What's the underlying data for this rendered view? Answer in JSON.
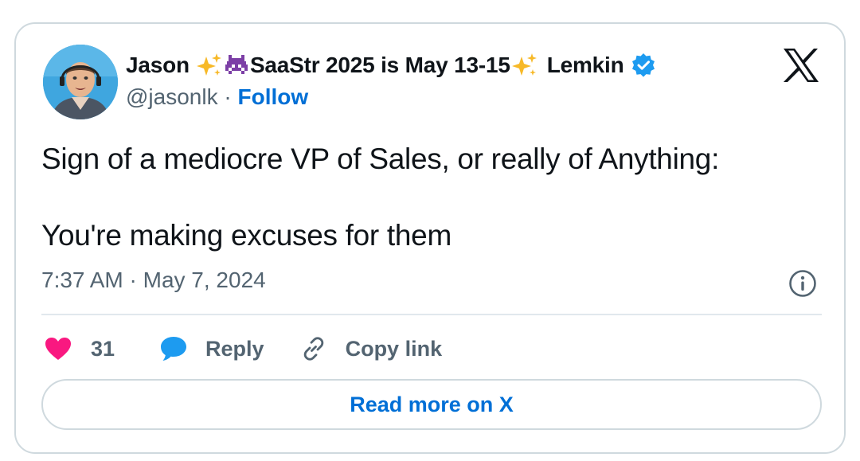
{
  "author": {
    "name_first": "Jason",
    "name_middle": "SaaStr 2025 is May 13-15",
    "name_last": "Lemkin",
    "handle": "@jasonlk",
    "separator": " · ",
    "follow_label": "Follow"
  },
  "tweet": {
    "line1": "Sign of a mediocre VP of Sales, or really of Anything:",
    "line2": "You're making excuses for them",
    "timestamp": "7:37 AM · May 7, 2024"
  },
  "actions": {
    "like_count": "31",
    "reply_label": "Reply",
    "copy_link_label": "Copy link"
  },
  "read_more_label": "Read more on X",
  "icons": {
    "avatar": "avatar-photo",
    "sparkles": "sparkles-icon",
    "invader": "alien-monster-icon",
    "verified": "verified-badge-icon",
    "brand": "x-logo-icon",
    "info": "info-icon",
    "like": "heart-icon",
    "reply": "speech-bubble-icon",
    "link": "link-icon"
  },
  "colors": {
    "text": "#0f1419",
    "secondary": "#536471",
    "link_blue": "#006fd6",
    "verified_blue": "#1d9bf0",
    "heart": "#f91880",
    "reply_bubble": "#1d9bf0",
    "border": "#cfd9de",
    "invader_purple": "#7c3fa6",
    "sparkle_gold": "#f7b928"
  }
}
